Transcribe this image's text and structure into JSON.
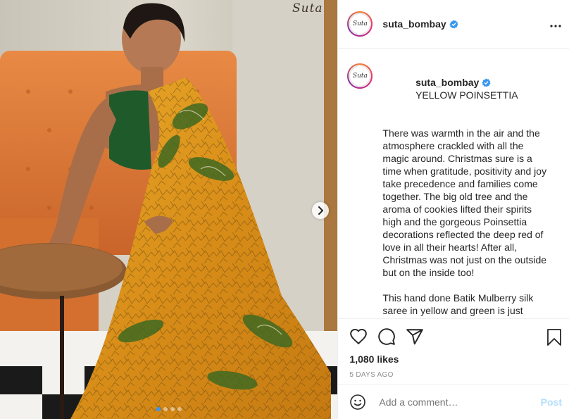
{
  "post": {
    "username": "suta_bombay",
    "avatar_text": "Suta",
    "watermark": "Suta",
    "more_icon": "ellipsis-icon",
    "caption_title": "YELLOW POINSETTIA",
    "caption_para1": "There was warmth in the air and the atmosphere crackled with all the magic around. Christmas sure is a time when gratitude, positivity and joy take precedence and families come together. The big old tree and the aroma of cookies lifted their spirits high and the gorgeous Poinsettia decorations reflected the deep red of love in all their hearts! After all, Christmas was not just on the outside but on the inside too!",
    "caption_para2": "This hand done Batik Mulberry silk saree in yellow and green is just perfection !",
    "likes": "1,080 likes",
    "time_ago": "5 DAYS AGO"
  },
  "comment": {
    "placeholder": "Add a comment…",
    "post_label": "Post"
  },
  "carousel": {
    "count": 4,
    "active_index": 0
  },
  "colors": {
    "accent": "#3897f0",
    "post_disabled": "#b2dffc",
    "muted": "#8e8e8e",
    "verified": "#3897f0"
  }
}
